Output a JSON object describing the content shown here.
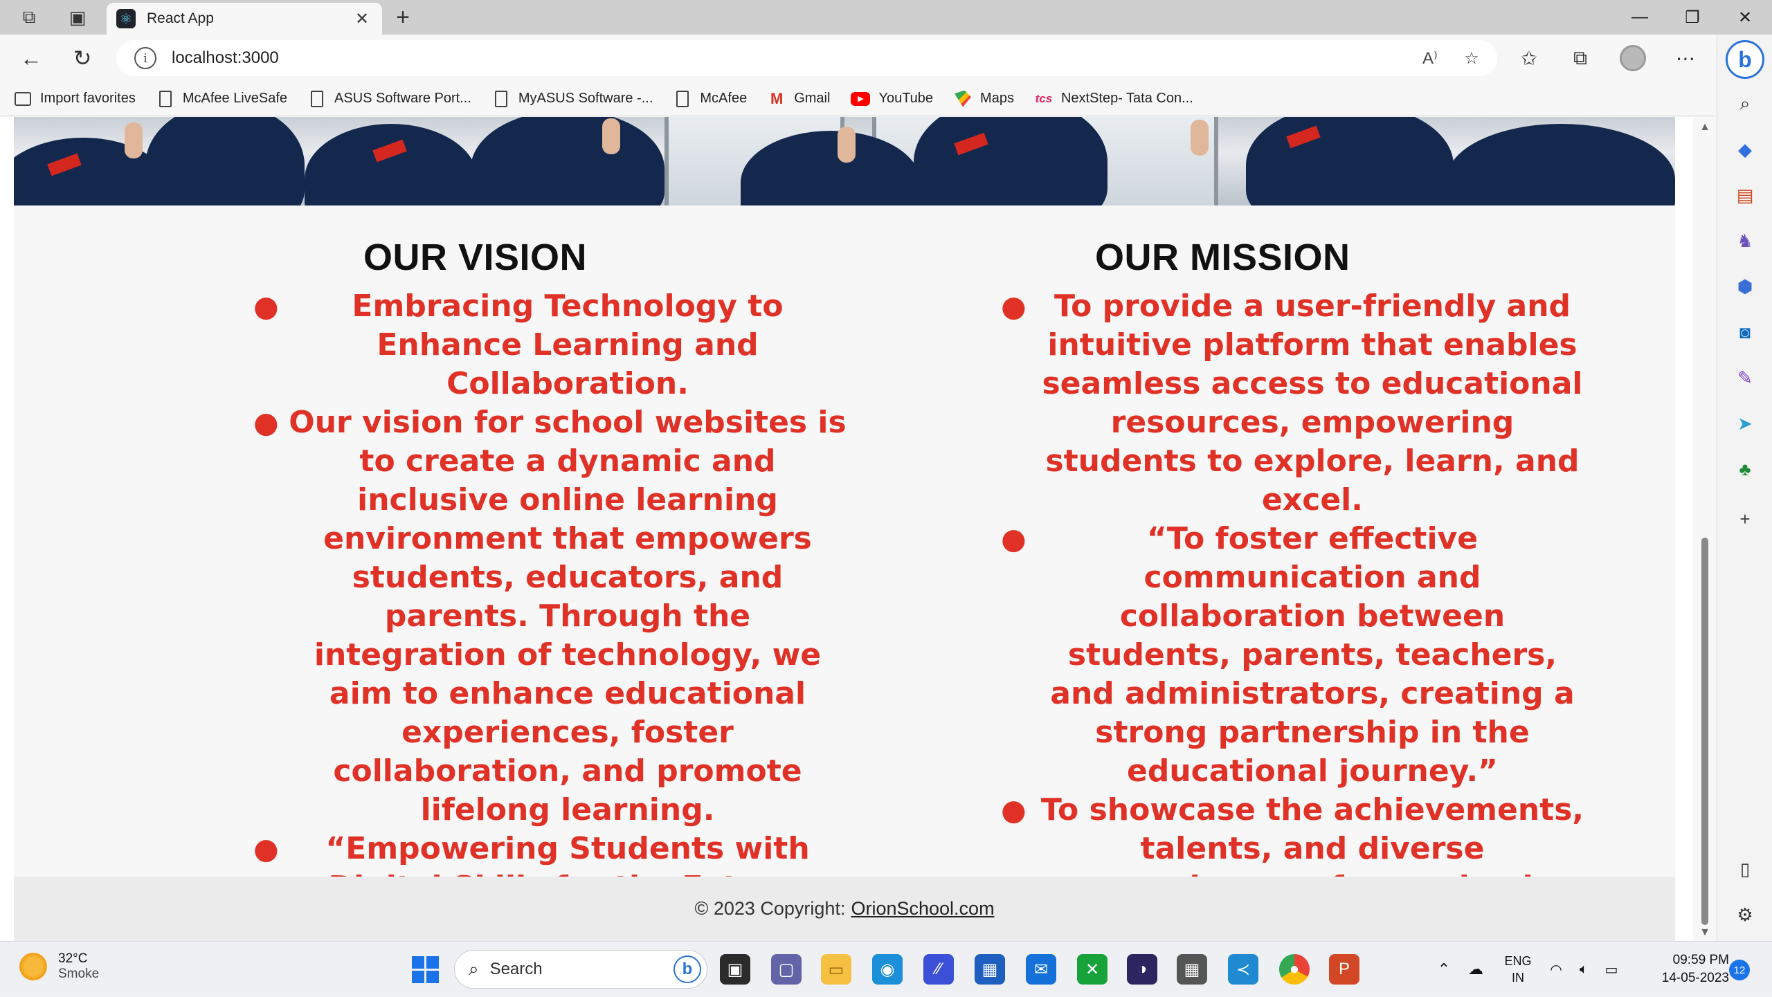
{
  "browser": {
    "tab_title": "React App",
    "tab_close": "✕",
    "new_tab": "+",
    "address": "localhost:3000",
    "window_controls": [
      "—",
      "❐",
      "✕"
    ]
  },
  "bookmarks": [
    {
      "label": "Import favorites",
      "icon": "import-favorites-icon"
    },
    {
      "label": "McAfee LiveSafe",
      "icon": "page-icon"
    },
    {
      "label": "ASUS Software Port...",
      "icon": "page-icon"
    },
    {
      "label": "MyASUS Software -...",
      "icon": "page-icon"
    },
    {
      "label": "McAfee",
      "icon": "page-icon"
    },
    {
      "label": "Gmail",
      "icon": "gmail-icon"
    },
    {
      "label": "YouTube",
      "icon": "youtube-icon"
    },
    {
      "label": "Maps",
      "icon": "maps-icon"
    },
    {
      "label": "NextStep- Tata Con...",
      "icon": "tcs-icon"
    }
  ],
  "page": {
    "vision": {
      "title": "OUR VISION",
      "items": [
        "Embracing Technology to Enhance Learning and Collaboration.",
        "Our vision for school websites is to create a dynamic and inclusive online learning environment that empowers students, educators, and parents. Through the integration of technology, we aim to enhance educational experiences, foster collaboration, and promote lifelong learning.",
        "“Empowering Students with Digital Skills for the Future."
      ]
    },
    "mission": {
      "title": "OUR MISSION",
      "items": [
        "To provide a user-friendly and intuitive platform that enables seamless access to educational resources, empowering students to explore, learn, and excel.",
        "“To foster effective communication and collaboration between students, parents, teachers, and administrators, creating a strong partnership in the educational journey.”",
        "To showcase the achievements, talents, and diverse experiences of our school community, promoting a sense of pride and unity."
      ]
    },
    "footer": {
      "text": "© 2023 Copyright:",
      "link": "OrionSchool.com"
    }
  },
  "taskbar": {
    "weather_temp": "32°C",
    "weather_cond": "Smoke",
    "search_placeholder": "Search",
    "lang": "ENG",
    "region": "IN",
    "time": "09:59 PM",
    "date": "14-05-2023",
    "notifications": "12"
  },
  "colors": {
    "accent_red": "#e03127",
    "heading": "#111111",
    "page_bg": "#f7f7f7"
  }
}
